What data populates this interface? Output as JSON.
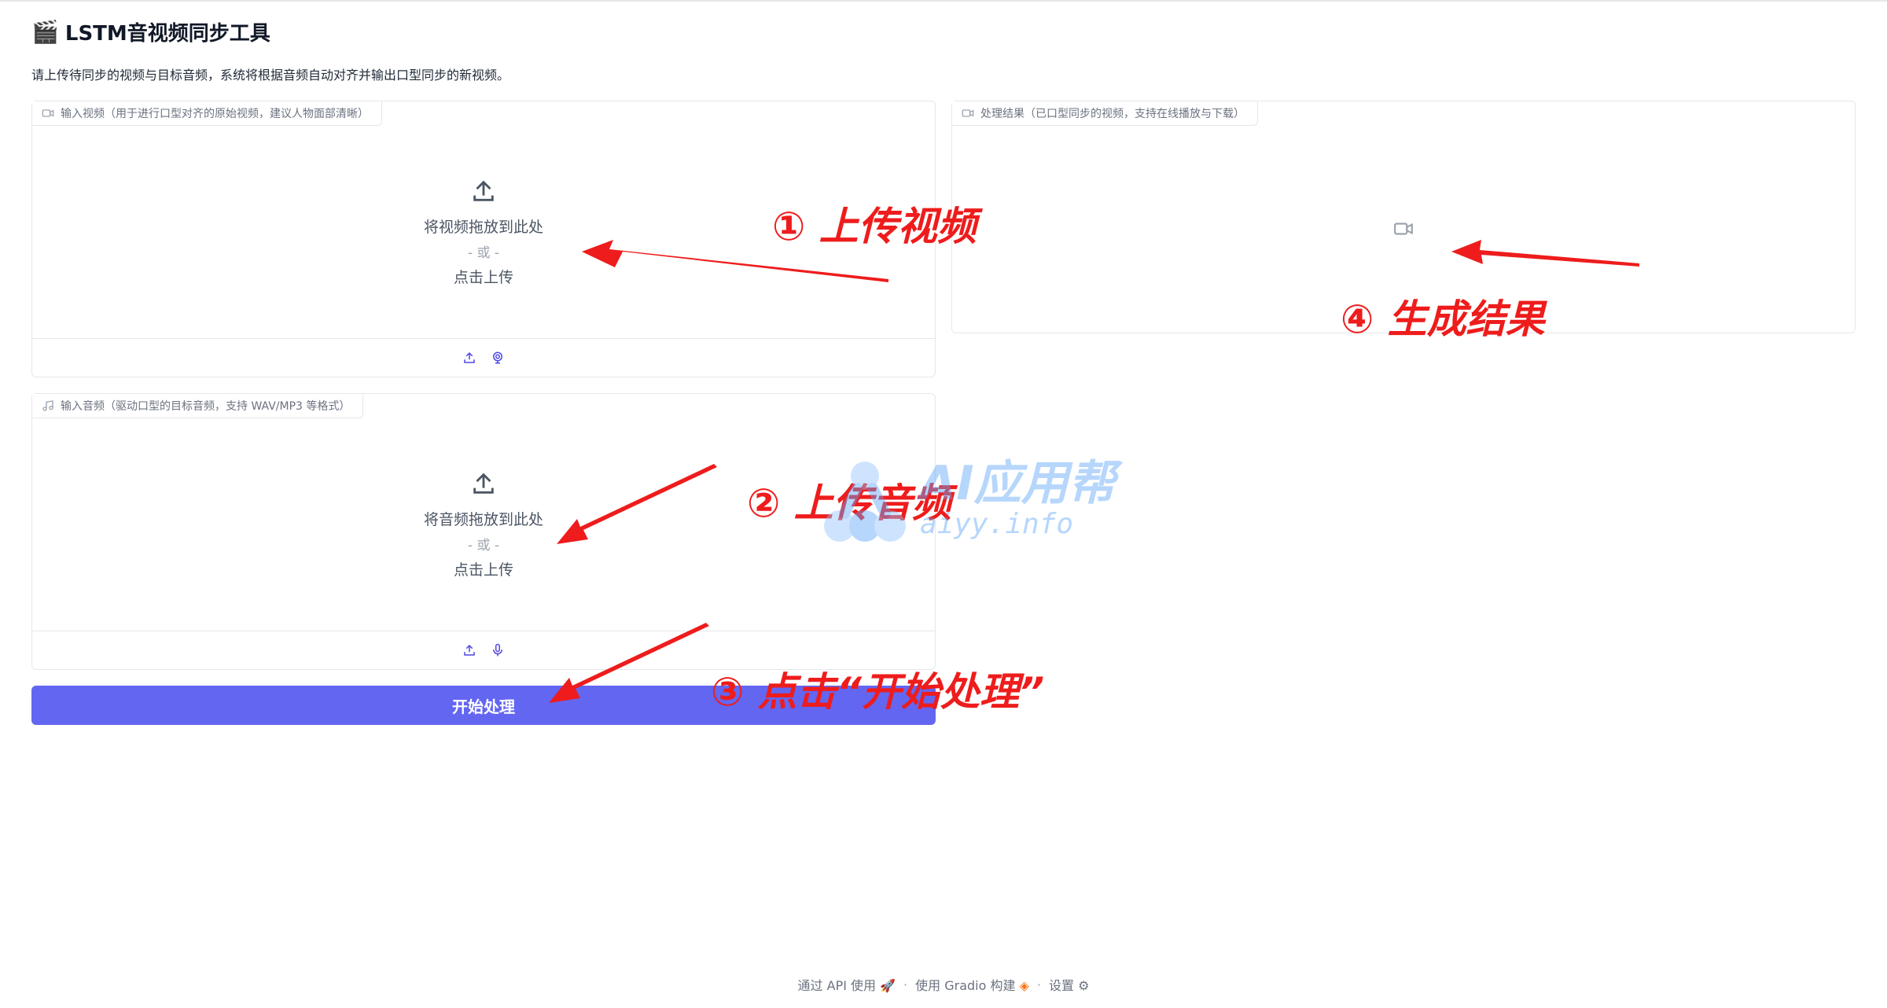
{
  "header": {
    "title_emoji": "🎬",
    "title": "LSTM音视频同步工具",
    "description": "请上传待同步的视频与目标音频，系统将根据音频自动对齐并输出口型同步的新视频。"
  },
  "video_input": {
    "label": "输入视频（用于进行口型对齐的原始视频，建议人物面部清晰）",
    "drop_text": "将视频拖放到此处",
    "or_text": "- 或 -",
    "click_text": "点击上传",
    "label_icon": "video-camera-icon",
    "sources": [
      "upload-icon",
      "webcam-icon"
    ]
  },
  "audio_input": {
    "label": "输入音频（驱动口型的目标音频，支持 WAV/MP3 等格式）",
    "drop_text": "将音频拖放到此处",
    "or_text": "- 或 -",
    "click_text": "点击上传",
    "label_icon": "music-note-icon",
    "sources": [
      "upload-icon",
      "microphone-icon"
    ]
  },
  "output": {
    "label": "处理结果（已口型同步的视频，支持在线播放与下载）",
    "label_icon": "video-camera-icon",
    "placeholder_icon": "video-camera-icon"
  },
  "actions": {
    "process_label": "开始处理"
  },
  "footer": {
    "api_label": "通过 API 使用",
    "built_label": "使用 Gradio 构建",
    "settings_label": "设置",
    "separator": "·"
  },
  "annotations": {
    "step1": "① 上传视频",
    "step2": "② 上传音频",
    "step3": "③ 点击“开始处理”",
    "step4": "④ 生成结果",
    "color": "#ee1c1c"
  },
  "watermark": {
    "name": "AI应用帮",
    "url": "aiyy.info"
  },
  "colors": {
    "primary": "#6366f1",
    "border": "#e5e7eb",
    "muted_text": "#6b7280"
  }
}
